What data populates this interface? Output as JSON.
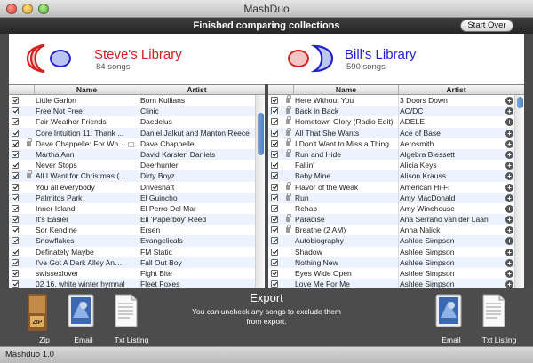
{
  "window": {
    "title": "MashDuo"
  },
  "status": {
    "message": "Finished comparing collections",
    "start_over": "Start Over"
  },
  "libraries": {
    "left": {
      "name": "Steve's Library",
      "count": "84 songs",
      "name_color": "#d32020"
    },
    "right": {
      "name": "Bill's Library",
      "count": "590 songs",
      "name_color": "#2222c8"
    }
  },
  "columns": {
    "name": "Name",
    "artist": "Artist"
  },
  "left_rows": [
    {
      "name": "Little Garlon",
      "artist": "Born Kullians",
      "lock": false
    },
    {
      "name": "Free Not Free",
      "artist": "Clinic",
      "lock": false
    },
    {
      "name": "Fair Weather Friends",
      "artist": "Daedelus",
      "lock": false
    },
    {
      "name": "Core Intuition 11: Thank ...",
      "artist": "Daniel Jalkut and Manton Reece",
      "lock": false
    },
    {
      "name": "Dave Chappelle: For What ...",
      "artist": "Dave Chappelle",
      "lock": true,
      "speech": true
    },
    {
      "name": "Martha Ann",
      "artist": "David Karsten Daniels",
      "lock": false
    },
    {
      "name": "Never Stops",
      "artist": "Deerhunter",
      "lock": false
    },
    {
      "name": "All I Want for Christmas (...",
      "artist": "Dirty Boyz",
      "lock": true
    },
    {
      "name": "You all everybody",
      "artist": "Driveshaft",
      "lock": false
    },
    {
      "name": "Palmitos Park",
      "artist": "El Guincho",
      "lock": false
    },
    {
      "name": "Inner Island",
      "artist": "El Perro Del Mar",
      "lock": false
    },
    {
      "name": "It's Easier",
      "artist": "Eli 'Paperboy' Reed",
      "lock": false
    },
    {
      "name": "Sor Kendine",
      "artist": "Ersen",
      "lock": false
    },
    {
      "name": "Snowflakes",
      "artist": "Evangelicals",
      "lock": false
    },
    {
      "name": "Definately Maybe",
      "artist": "FM Static",
      "lock": false
    },
    {
      "name": "I've Got A Dark Alley And A B",
      "artist": "Fall Out Boy",
      "lock": false
    },
    {
      "name": "swissexlover",
      "artist": "Fight Bite",
      "lock": false
    },
    {
      "name": "02 16. white winter hymnal",
      "artist": "Fleet Foxes",
      "lock": false
    },
    {
      "name": "Abandon",
      "artist": "French Kicks",
      "lock": false
    }
  ],
  "right_rows": [
    {
      "name": "Here Without You",
      "artist": "3 Doors Down",
      "lock": true
    },
    {
      "name": "Back in Back",
      "artist": "AC/DC",
      "lock": true
    },
    {
      "name": "Hometown Glory (Radio Edit)",
      "artist": "ADELE",
      "lock": true
    },
    {
      "name": "All That She Wants",
      "artist": "Ace of Base",
      "lock": true
    },
    {
      "name": "I Don't Want to Miss a Thing",
      "artist": "Aerosmith",
      "lock": true
    },
    {
      "name": "Run and Hide",
      "artist": "Algebra Blessett",
      "lock": true
    },
    {
      "name": "Fallin'",
      "artist": "Alicia Keys",
      "lock": false
    },
    {
      "name": "Baby Mine",
      "artist": "Alison Krauss",
      "lock": false
    },
    {
      "name": "Flavor of the Weak",
      "artist": "American Hi-Fi",
      "lock": true
    },
    {
      "name": "Run",
      "artist": "Amy MacDonald",
      "lock": true
    },
    {
      "name": "Rehab",
      "artist": "Amy Winehouse",
      "lock": false
    },
    {
      "name": "Paradise",
      "artist": "Ana Serrano van der Laan",
      "lock": true
    },
    {
      "name": "Breathe (2 AM)",
      "artist": "Anna Nalick",
      "lock": true
    },
    {
      "name": "Autobiography",
      "artist": "Ashlee Simpson",
      "lock": false
    },
    {
      "name": "Shadow",
      "artist": "Ashlee Simpson",
      "lock": false
    },
    {
      "name": "Nothing New",
      "artist": "Ashlee Simpson",
      "lock": false
    },
    {
      "name": "Eyes Wide Open",
      "artist": "Ashlee Simpson",
      "lock": false
    },
    {
      "name": "Love Me For Me",
      "artist": "Ashlee Simpson",
      "lock": false
    }
  ],
  "export": {
    "title": "Export",
    "subtitle": "You can uncheck any songs to exclude them from export.",
    "left_actions": [
      {
        "label": "Zip",
        "icon": "zip-icon"
      },
      {
        "label": "Email",
        "icon": "mail-stamp-icon"
      },
      {
        "label": "Txt Listing",
        "icon": "text-document-icon"
      }
    ],
    "right_actions": [
      {
        "label": "Email",
        "icon": "mail-stamp-icon"
      },
      {
        "label": "Txt Listing",
        "icon": "text-document-icon"
      }
    ]
  },
  "footer": {
    "version": "Mashduo 1.0"
  }
}
